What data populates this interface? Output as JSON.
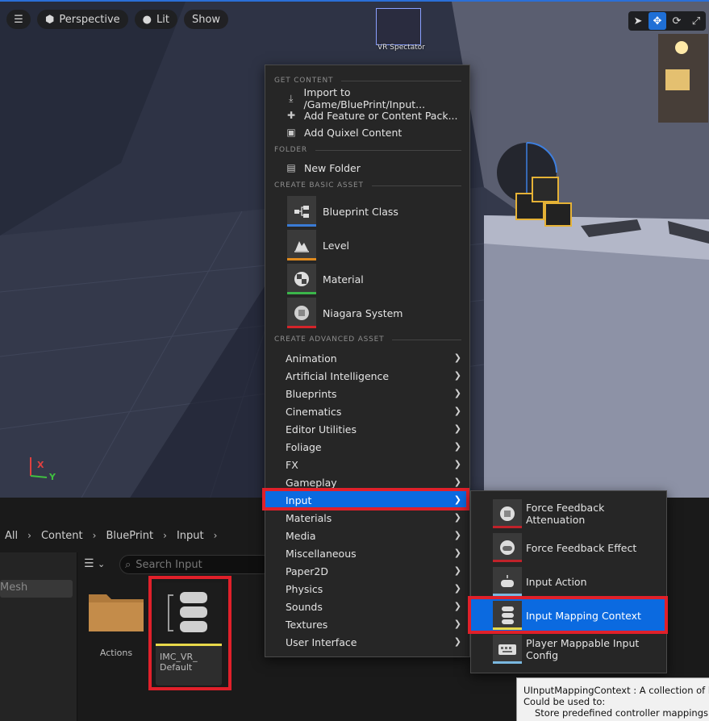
{
  "viewport": {
    "toolbar": {
      "perspective_label": "Perspective",
      "lit_label": "Lit",
      "show_label": "Show"
    },
    "vr_spectator_label": "VR Spectator",
    "axis_x": "X",
    "axis_y": "Y"
  },
  "menu": {
    "get_content": {
      "header": "GET CONTENT",
      "items": [
        {
          "label": "Import to /Game/BluePrint/Input...",
          "icon": "import-icon"
        },
        {
          "label": "Add Feature or Content Pack...",
          "icon": "feature-pack-icon"
        },
        {
          "label": "Add Quixel Content",
          "icon": "quixel-icon"
        }
      ]
    },
    "folder": {
      "header": "FOLDER",
      "items": [
        {
          "label": "New Folder",
          "icon": "new-folder-icon"
        }
      ]
    },
    "basic": {
      "header": "CREATE BASIC ASSET",
      "items": [
        {
          "label": "Blueprint Class",
          "icon": "blueprint-class-icon",
          "color": "#3a7bd5"
        },
        {
          "label": "Level",
          "icon": "level-icon",
          "color": "#e08a1e"
        },
        {
          "label": "Material",
          "icon": "material-icon",
          "color": "#3bb54a"
        },
        {
          "label": "Niagara System",
          "icon": "niagara-icon",
          "color": "#d4242a"
        }
      ]
    },
    "advanced": {
      "header": "CREATE ADVANCED ASSET",
      "items": [
        {
          "label": "Animation"
        },
        {
          "label": "Artificial Intelligence"
        },
        {
          "label": "Blueprints"
        },
        {
          "label": "Cinematics"
        },
        {
          "label": "Editor Utilities"
        },
        {
          "label": "Foliage"
        },
        {
          "label": "FX"
        },
        {
          "label": "Gameplay"
        },
        {
          "label": "Input",
          "selected": true
        },
        {
          "label": "Materials"
        },
        {
          "label": "Media"
        },
        {
          "label": "Miscellaneous"
        },
        {
          "label": "Paper2D"
        },
        {
          "label": "Physics"
        },
        {
          "label": "Sounds"
        },
        {
          "label": "Textures"
        },
        {
          "label": "User Interface"
        }
      ]
    }
  },
  "submenu": {
    "items": [
      {
        "label": "Force Feedback Attenuation",
        "icon": "force-feedback-attenuation-icon",
        "color": "#c0222a"
      },
      {
        "label": "Force Feedback Effect",
        "icon": "force-feedback-effect-icon",
        "color": "#c0222a"
      },
      {
        "label": "Input Action",
        "icon": "input-action-icon",
        "color": "#7ab8e0"
      },
      {
        "label": "Input Mapping Context",
        "icon": "input-mapping-context-icon",
        "color": "#e8d84a",
        "selected": true
      },
      {
        "label": "Player Mappable Input Config",
        "icon": "player-mappable-input-config-icon",
        "color": "#7ab8e0"
      }
    ]
  },
  "content_browser": {
    "breadcrumb": [
      "All",
      "Content",
      "BluePrint",
      "Input"
    ],
    "search_placeholder": "Search Input",
    "left_panel_item": "Mesh",
    "folder_label": "Actions",
    "asset_name_line1": "IMC_VR_",
    "asset_name_line2": "Default"
  },
  "tooltip": {
    "line1": "UInputMappingContext : A collection of key",
    "line2": "Could be used to:",
    "line3": "Store predefined controller mappings (a"
  },
  "colors": {
    "selection": "#0b6ae0",
    "highlight": "#e0202a",
    "menu_bg": "#262626"
  }
}
